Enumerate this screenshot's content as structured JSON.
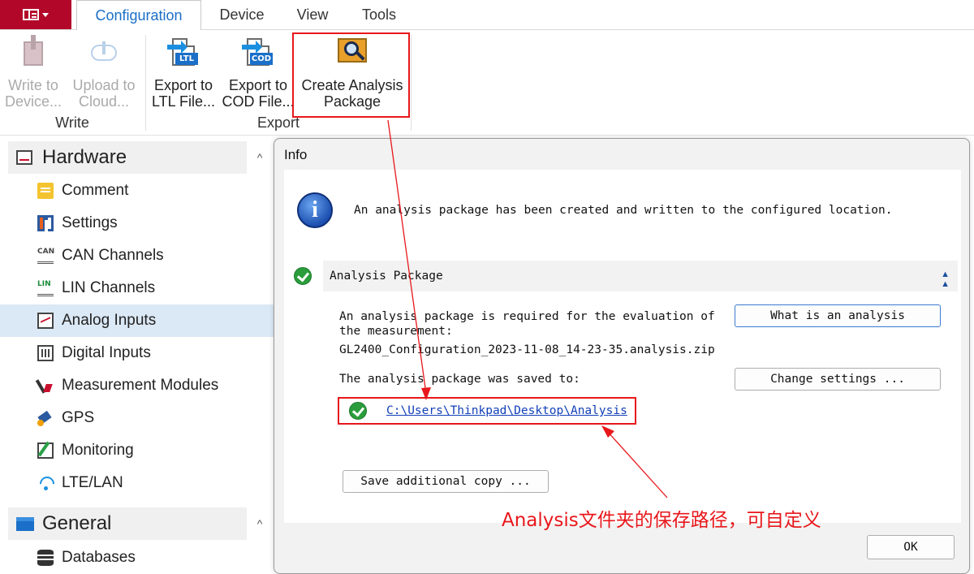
{
  "tabs": {
    "configuration": "Configuration",
    "device": "Device",
    "view": "View",
    "tools": "Tools"
  },
  "ribbon": {
    "write_to_device": "Write to\nDevice...",
    "upload_to_cloud": "Upload to\nCloud...",
    "export_ltl": "Export to\nLTL File...",
    "export_cod": "Export to\nCOD File...",
    "create_analysis": "Create Analysis\nPackage",
    "group_write": "Write",
    "group_export": "Export",
    "ltl_tag": "LTL",
    "cod_tag": "COD"
  },
  "sidebar": {
    "hardware": "Hardware",
    "general": "General",
    "items": [
      {
        "label": "Comment"
      },
      {
        "label": "Settings"
      },
      {
        "label": "CAN Channels"
      },
      {
        "label": "LIN Channels"
      },
      {
        "label": "Analog Inputs"
      },
      {
        "label": "Digital Inputs"
      },
      {
        "label": "Measurement Modules"
      },
      {
        "label": "GPS"
      },
      {
        "label": "Monitoring"
      },
      {
        "label": "LTE/LAN"
      }
    ],
    "general_items": [
      {
        "label": "Databases"
      }
    ],
    "can_tag": "CAN",
    "lin_tag": "LIN",
    "collapse_glyph": "^"
  },
  "dialog": {
    "title": "Info",
    "message": "An analysis package has been created and written to the configured location.",
    "section_title": "Analysis Package",
    "required_text": "An analysis package is required for the evaluation of the measurement:",
    "filename": "GL2400_Configuration_2023-11-08_14-23-35.analysis.zip",
    "saved_text": "The analysis package was saved to:",
    "saved_path": "C:\\Users\\Thinkpad\\Desktop\\Analysis",
    "what_button": "What is an analysis",
    "change_button": "Change settings ...",
    "save_copy_button": "Save additional copy ...",
    "ok_button": "OK"
  },
  "annotation": "Analysis文件夹的保存路径，可自定义",
  "colors": {
    "accent": "#1a6fc8",
    "app_button": "#b3072a",
    "highlight": "#e8171b",
    "selected_row": "#dbe8f5"
  }
}
